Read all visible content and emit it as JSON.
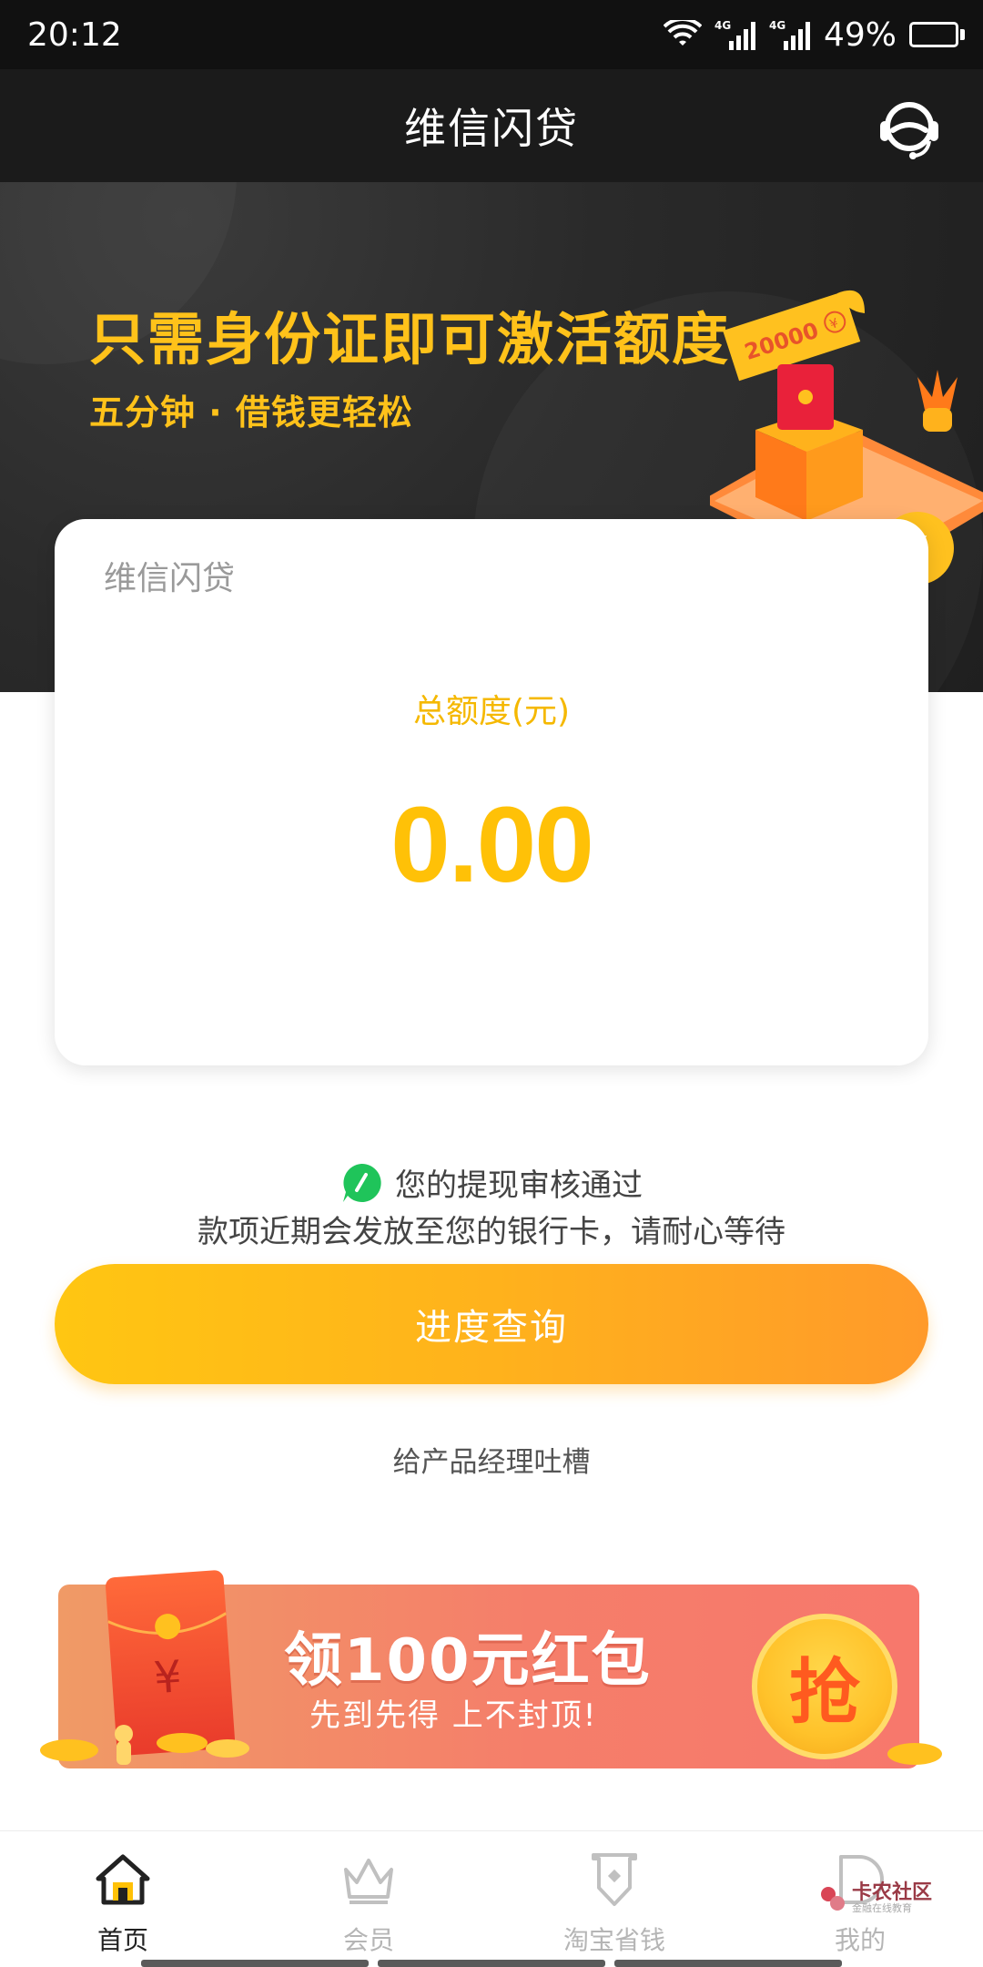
{
  "status_bar": {
    "time": "20:12",
    "network_1": "4G",
    "network_2": "4G",
    "battery": "49%",
    "battery_level": 0.49
  },
  "header": {
    "title": "维信闪贷",
    "service_icon": "customer-service-icon"
  },
  "banner": {
    "title": "只需身份证即可激活额度",
    "subtitle": "五分钟 · 借钱更轻松",
    "ticket_amount": "20000",
    "ticket_currency": "¥",
    "coin_symbol": "¥"
  },
  "card": {
    "brand": "维信闪贷",
    "label": "总额度(元)",
    "amount": "0.00"
  },
  "notice": {
    "line1": "您的提现审核通过",
    "line2": "款项近期会发放至您的银行卡，请耐心等待",
    "icon": "check-bubble-icon"
  },
  "actions": {
    "progress_label": "进度查询",
    "feedback_label": "给产品经理吐槽"
  },
  "promo": {
    "title": "领100元红包",
    "subtitle": "先到先得 上不封顶!",
    "grab_label": "抢",
    "envelope_symbol": "¥"
  },
  "bottom_nav": {
    "items": [
      {
        "label": "首页",
        "icon": "home-icon",
        "active": true
      },
      {
        "label": "会员",
        "icon": "crown-icon",
        "active": false
      },
      {
        "label": "淘宝省钱",
        "icon": "shield-tag-icon",
        "active": false
      },
      {
        "label": "我的",
        "icon": "user-icon",
        "active": false
      }
    ]
  },
  "watermark": {
    "text": "卡农社区",
    "sub": "金融在线教育"
  },
  "colors": {
    "accent": "#ffc107",
    "header_bg": "#1b1b1b",
    "button_start": "#ffc612",
    "button_end": "#ff9a2a",
    "promo_red": "#f57e6a"
  }
}
